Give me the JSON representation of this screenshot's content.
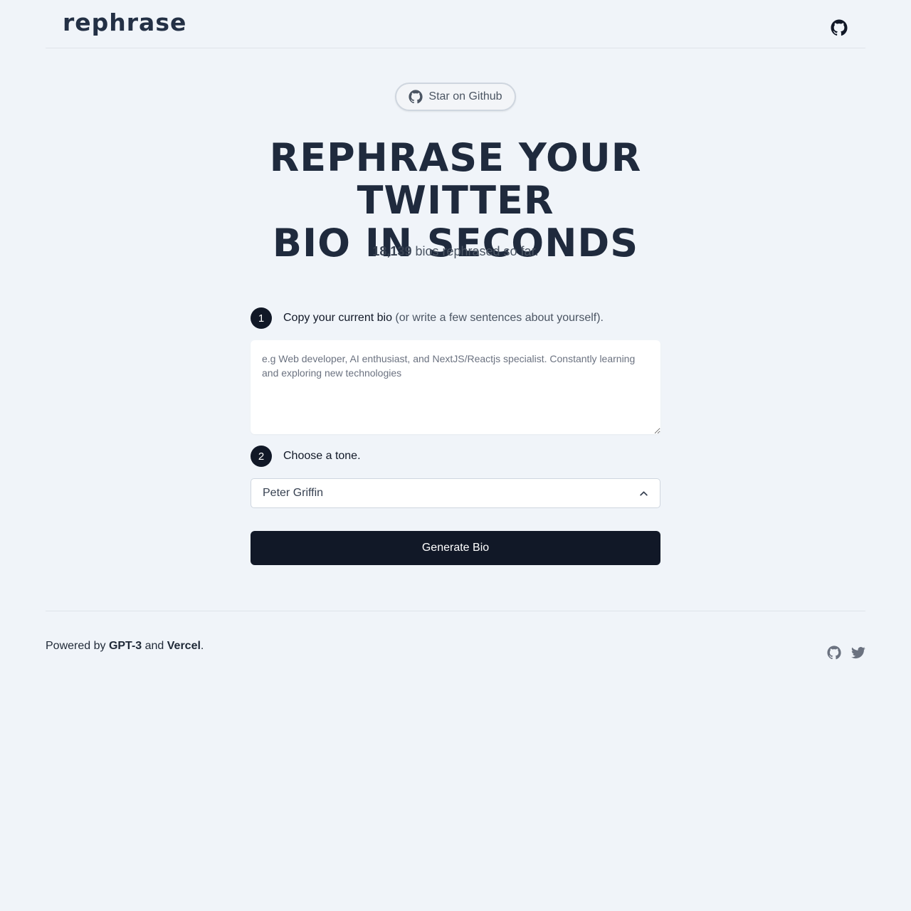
{
  "header": {
    "logo": "rephrase",
    "github_icon": "github-icon"
  },
  "hero": {
    "star_button_label": "Star on Github",
    "title_line1": "Rephrase your Twitter",
    "title_line2": "bio in seconds",
    "count": "18,139",
    "count_suffix": " bios rephrased so far."
  },
  "form": {
    "step1": {
      "number": "1",
      "label": "Copy your current bio",
      "label_hint": " (or write a few sentences about yourself)."
    },
    "bio_placeholder": "e.g Web developer, AI enthusiast, and NextJS/Reactjs specialist. Constantly learning and exploring new technologies",
    "bio_value": "",
    "step2": {
      "number": "2",
      "label": "Choose a tone."
    },
    "tone_selected": "Peter Griffin",
    "generate_label": "Generate Bio"
  },
  "footer": {
    "powered_prefix": "Powered by ",
    "gpt3": "GPT-3",
    "and": " and ",
    "vercel": "Vercel",
    "period": ".",
    "icons": [
      "github-icon",
      "twitter-icon"
    ]
  },
  "colors": {
    "background": "#f0f4f9",
    "primary_dark": "#111827",
    "text": "#1f2a3d",
    "muted": "#4b5563"
  }
}
